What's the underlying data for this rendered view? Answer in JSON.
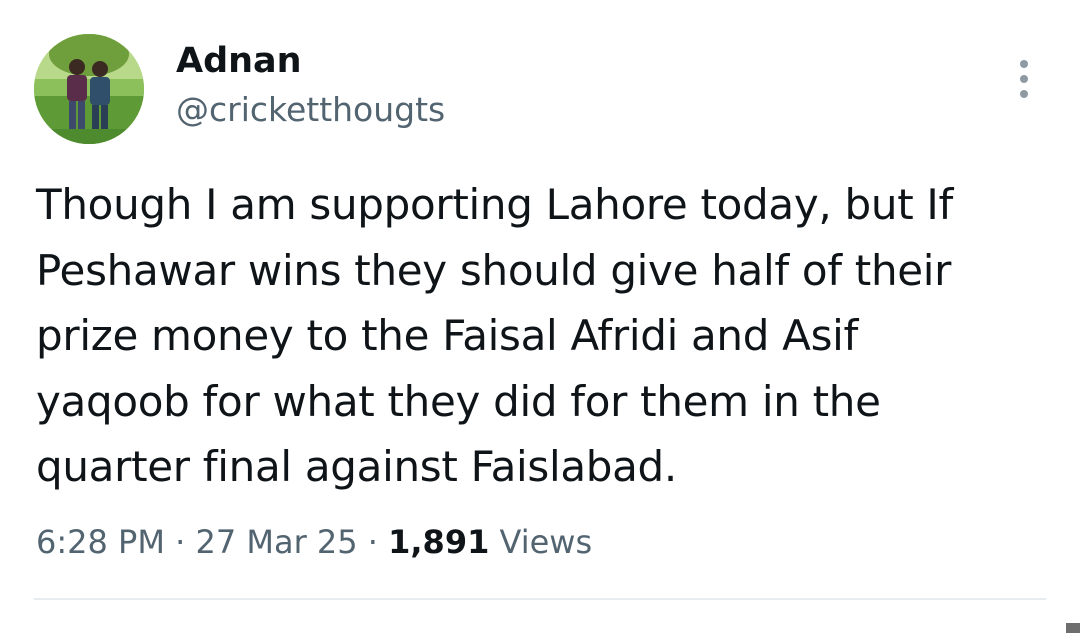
{
  "user": {
    "display_name": "Adnan",
    "handle": "@cricketthougts",
    "avatar_icon": "profile-photo"
  },
  "tweet": {
    "text": "Though I am supporting Lahore today, but If\nPeshawar wins they should give half of their\nprize money to the Faisal Afridi and Asif\nyaqoob for what they did for them in the\nquarter final against Faislabad.",
    "time": "6:28 PM",
    "separator": "·",
    "date": "27 Mar 25",
    "views_count": "1,891",
    "views_label": "Views"
  },
  "icons": {
    "more": "more-vertical-icon"
  },
  "colors": {
    "text_primary": "#0f1419",
    "text_secondary": "#536471",
    "divider": "#e6ecf0"
  }
}
